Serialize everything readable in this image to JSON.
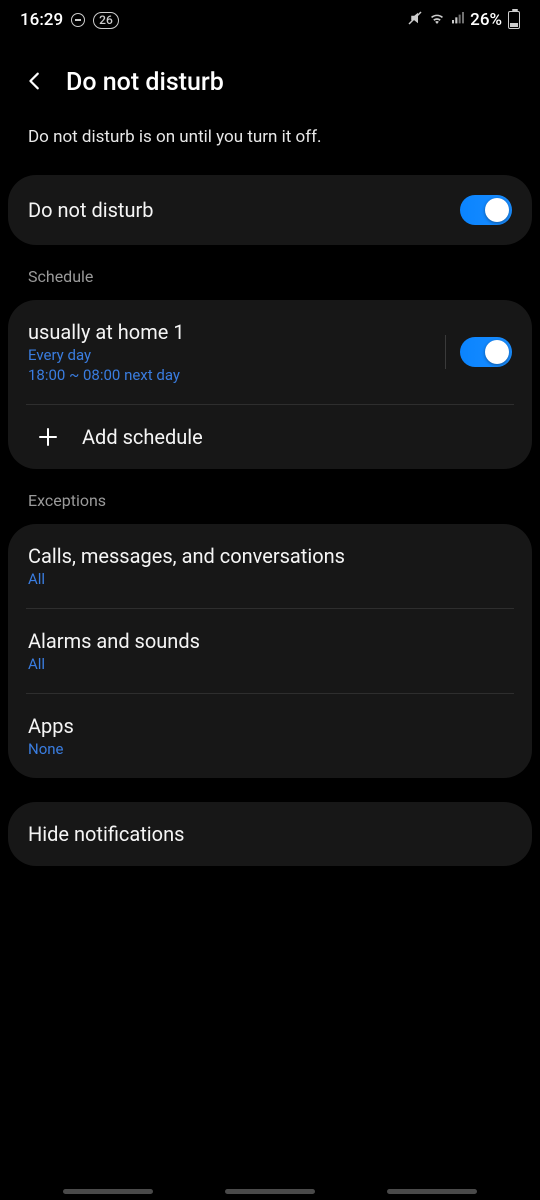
{
  "status": {
    "time": "16:29",
    "badge": "26",
    "battery": "26%"
  },
  "header": {
    "title": "Do not disturb"
  },
  "subtitle": "Do not disturb is on until you turn it off.",
  "master": {
    "label": "Do not disturb"
  },
  "scheduleLabel": "Schedule",
  "schedule": {
    "name": "usually at home 1",
    "days": "Every day",
    "time": "18:00 ~ 08:00 next day",
    "add": "Add schedule"
  },
  "exceptionsLabel": "Exceptions",
  "exceptions": {
    "calls": {
      "title": "Calls, messages, and conversations",
      "value": "All"
    },
    "alarms": {
      "title": "Alarms and sounds",
      "value": "All"
    },
    "apps": {
      "title": "Apps",
      "value": "None"
    }
  },
  "hide": {
    "title": "Hide notifications"
  }
}
